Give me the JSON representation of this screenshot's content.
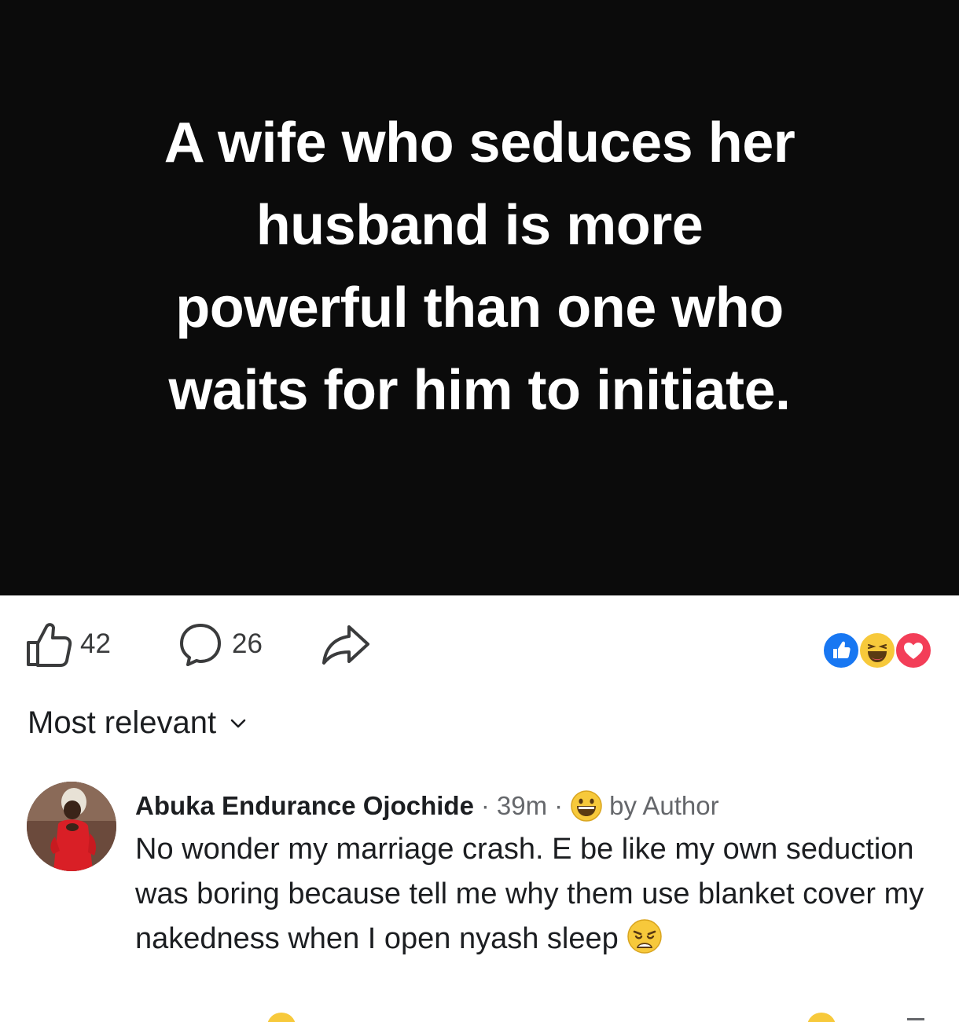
{
  "post": {
    "quote_lines": [
      "A wife who seduces her",
      "husband is more",
      "powerful than one who",
      "waits for him to initiate."
    ]
  },
  "actions": {
    "like_count": "42",
    "comment_count": "26"
  },
  "reactions": [
    "like-icon",
    "haha-icon",
    "love-icon"
  ],
  "sort": {
    "label": "Most relevant"
  },
  "comment": {
    "author": "Abuka Endurance Ojochide",
    "separator": "·",
    "time": "39m",
    "badge": "by Author",
    "text": "No wonder my marriage crash. E be like my own seduction was boring because tell me why them use blanket cover my nakedness when I open nyash sleep"
  },
  "colors": {
    "post_background": "#0b0b0b",
    "quote_text": "#ffffff",
    "like_blue": "#1877f2",
    "haha_yellow": "#f7c93b",
    "love_red": "#f33e58",
    "secondary_text": "#65676b"
  }
}
